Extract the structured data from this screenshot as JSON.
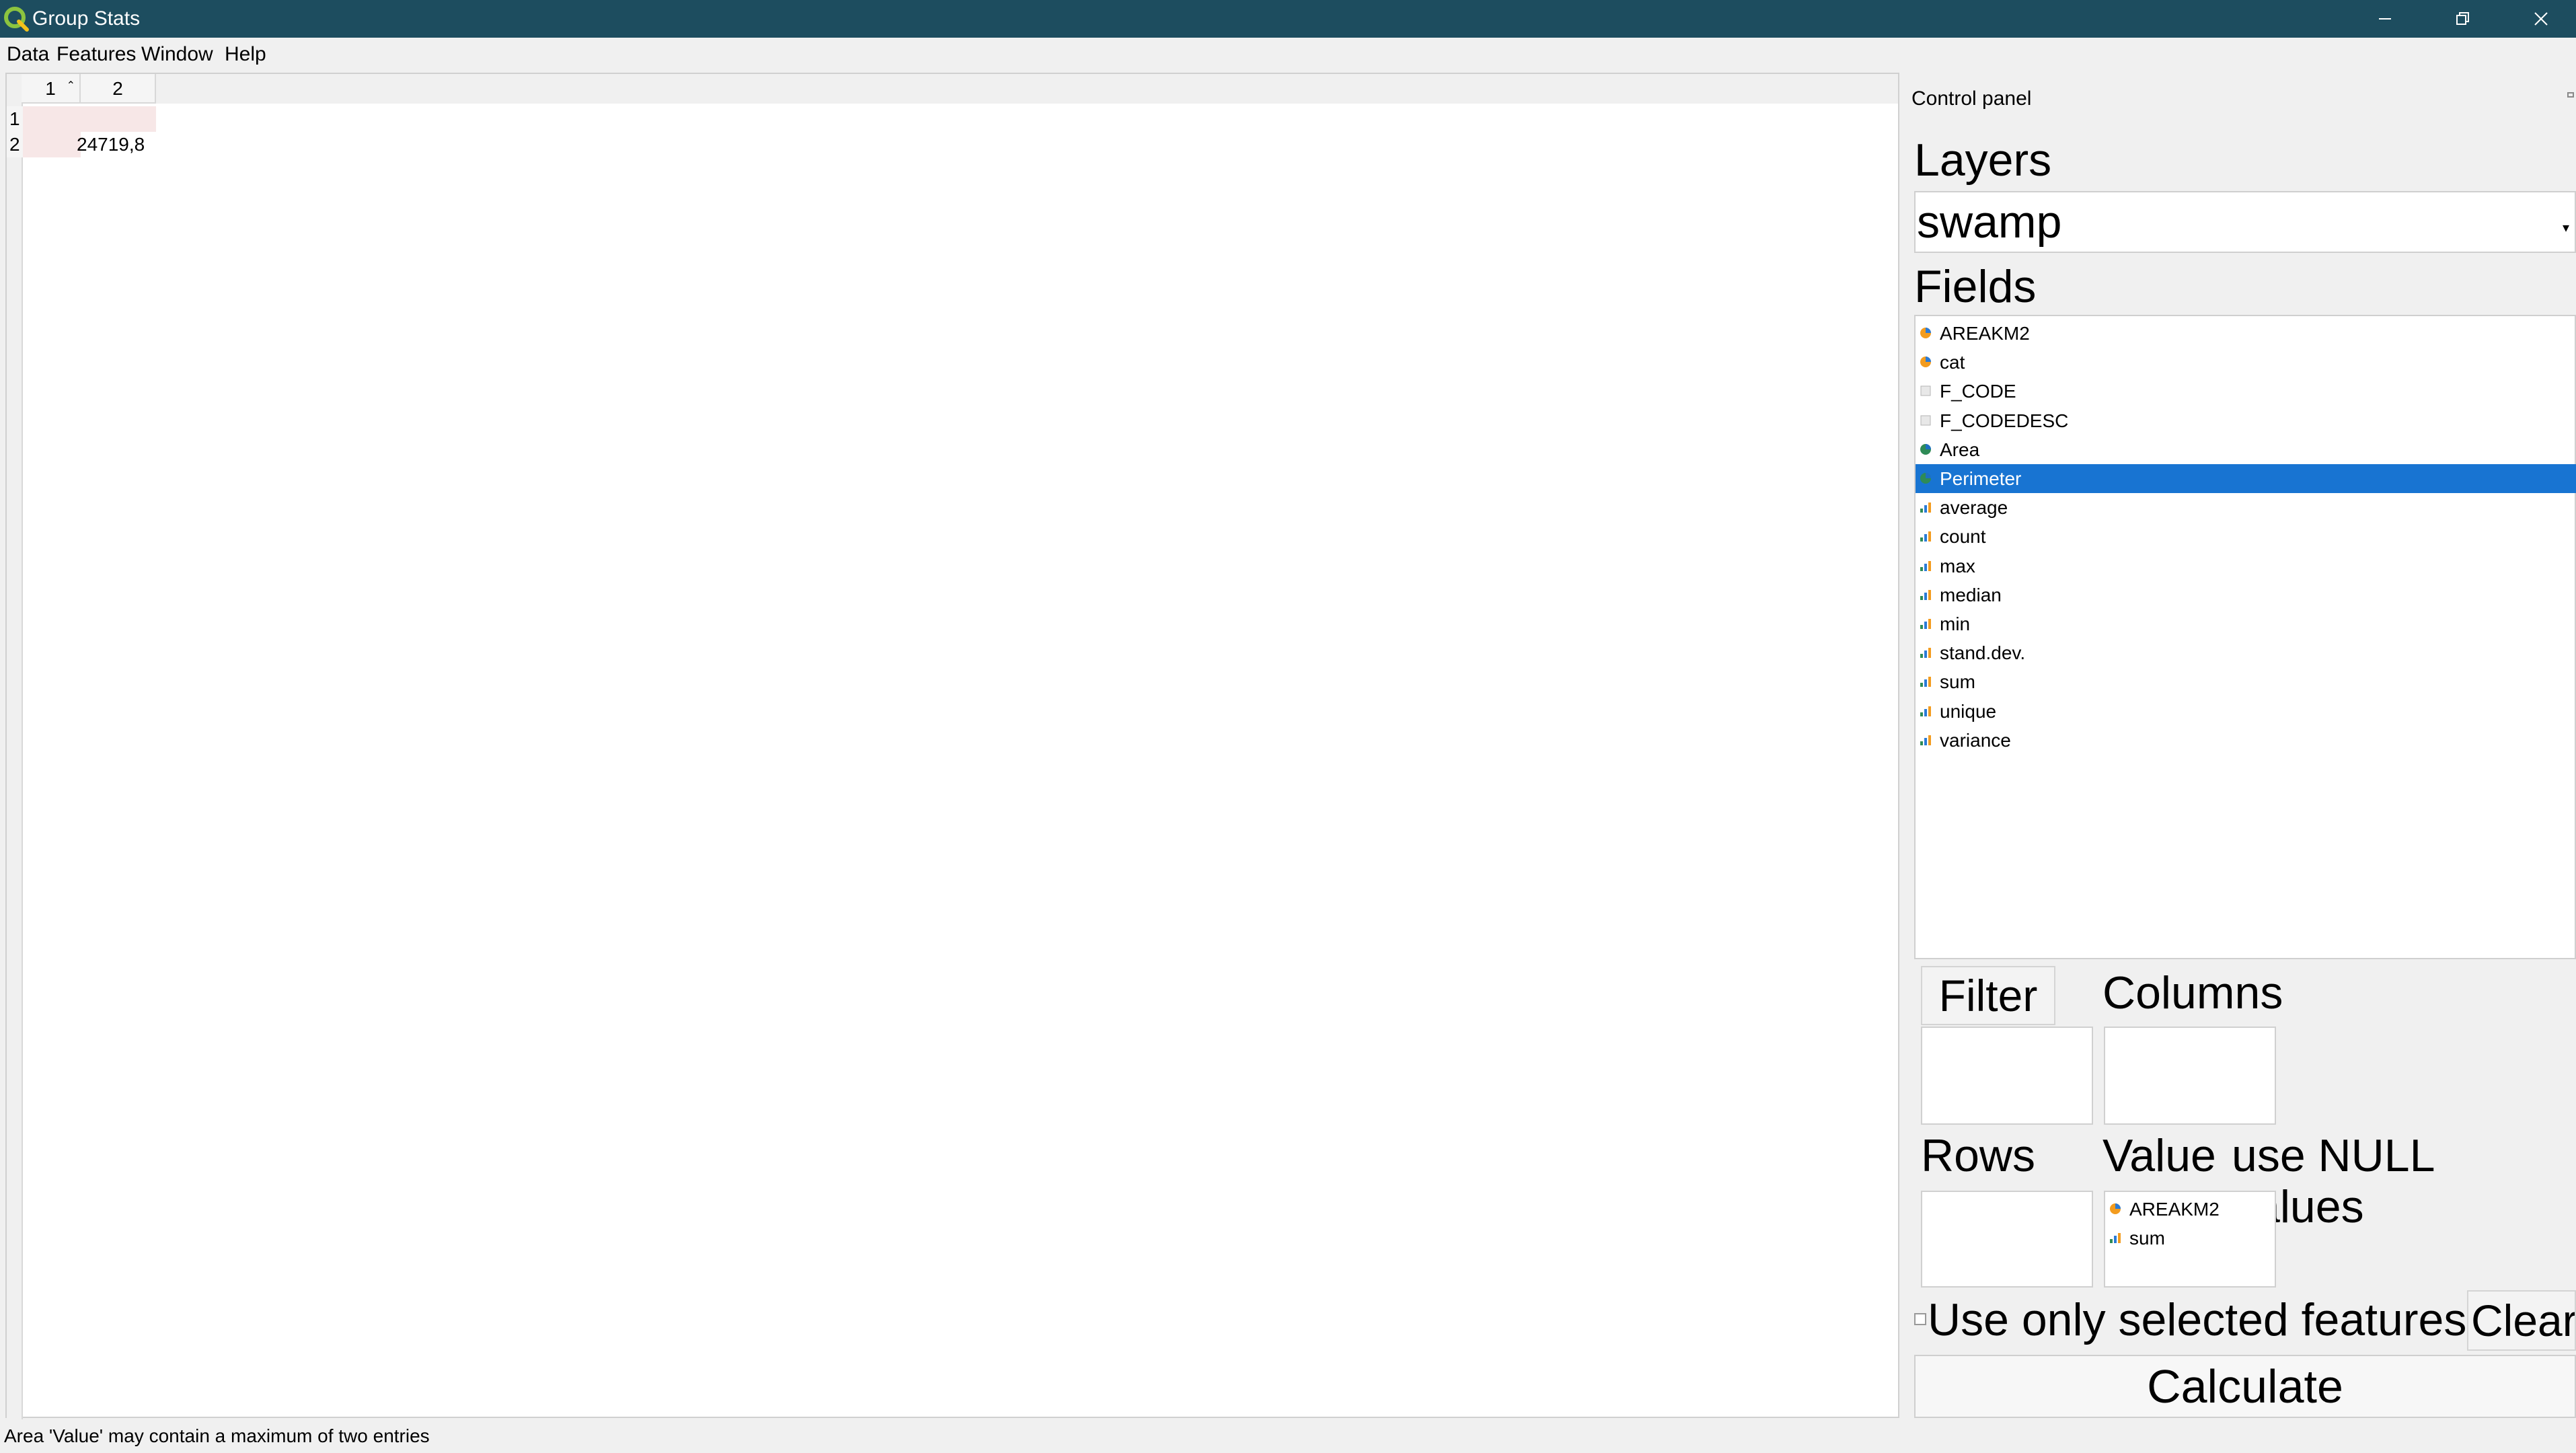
{
  "window": {
    "title": "Group Stats",
    "app_icon": "qgis-logo-icon",
    "controls": [
      "minimize-icon",
      "restore-icon",
      "close-icon"
    ]
  },
  "menu": {
    "items": [
      "Data",
      "Features",
      "Window",
      "Help"
    ]
  },
  "table": {
    "column_headers": [
      "1",
      "2"
    ],
    "row_headers": [
      "1",
      "2"
    ],
    "rows": [
      [
        "",
        ""
      ],
      [
        "",
        "24719,8"
      ]
    ]
  },
  "control_panel": {
    "title": "Control panel",
    "layers_label": "Layers",
    "layer_selected": "swamp",
    "fields_label": "Fields",
    "fields": [
      {
        "label": "AREAKM2",
        "icon": "numeric-field-icon",
        "selected": false
      },
      {
        "label": "cat",
        "icon": "numeric-field-icon",
        "selected": false
      },
      {
        "label": "F_CODE",
        "icon": "text-field-icon",
        "selected": false
      },
      {
        "label": "F_CODEDESC",
        "icon": "text-field-icon",
        "selected": false
      },
      {
        "label": "Area",
        "icon": "geometry-field-icon",
        "selected": false
      },
      {
        "label": "Perimeter",
        "icon": "geometry-field-icon",
        "selected": true
      },
      {
        "label": "average",
        "icon": "statistic-icon",
        "selected": false
      },
      {
        "label": "count",
        "icon": "statistic-icon",
        "selected": false
      },
      {
        "label": "max",
        "icon": "statistic-icon",
        "selected": false
      },
      {
        "label": "median",
        "icon": "statistic-icon",
        "selected": false
      },
      {
        "label": "min",
        "icon": "statistic-icon",
        "selected": false
      },
      {
        "label": "stand.dev.",
        "icon": "statistic-icon",
        "selected": false
      },
      {
        "label": "sum",
        "icon": "statistic-icon",
        "selected": false
      },
      {
        "label": "unique",
        "icon": "statistic-icon",
        "selected": false
      },
      {
        "label": "variance",
        "icon": "statistic-icon",
        "selected": false
      }
    ],
    "filter_button": "Filter",
    "columns_label": "Columns",
    "rows_label": "Rows",
    "value_label": "Value",
    "null_values_label": "use NULL values",
    "value_items": [
      {
        "label": "AREAKM2",
        "icon": "numeric-field-icon"
      },
      {
        "label": "sum",
        "icon": "statistic-icon"
      }
    ],
    "selected_features_label": "Use only selected features",
    "selected_features_checked": false,
    "clear_button": "Clear",
    "calculate_button": "Calculate"
  },
  "status": {
    "message": "Area 'Value' may contain a maximum of two entries"
  },
  "colors": {
    "titlebar": "#1d4d5f",
    "selection": "#1874d2",
    "cell_highlight": "#f7e7e7"
  }
}
